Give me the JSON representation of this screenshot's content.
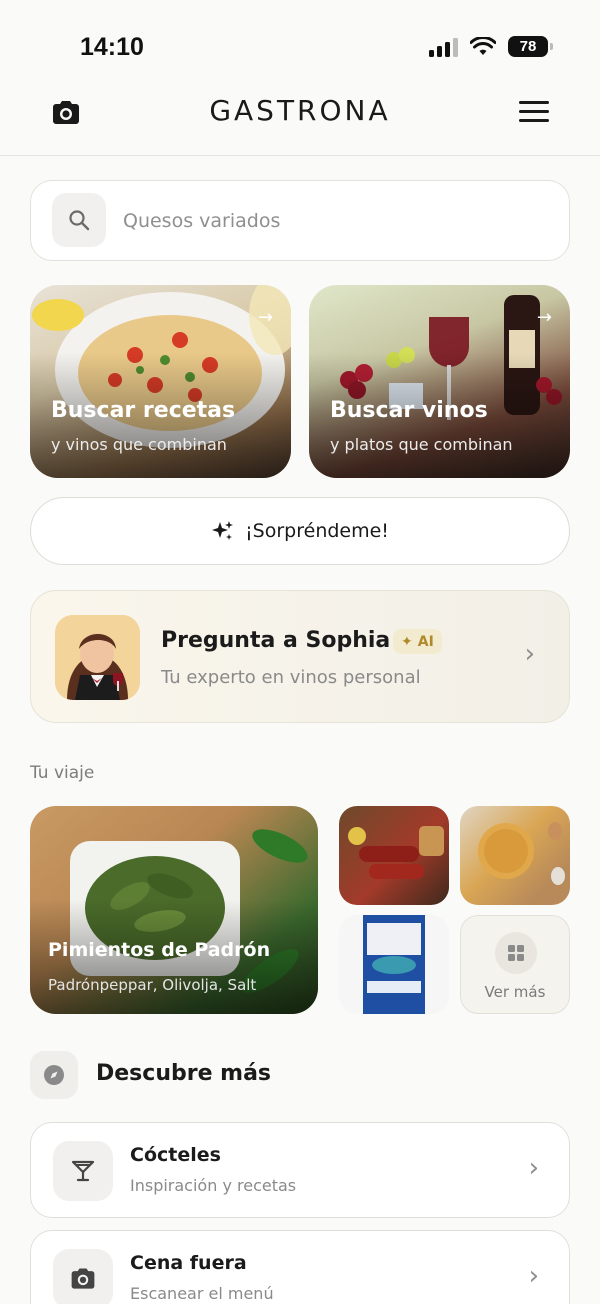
{
  "status": {
    "time": "14:10",
    "battery": "78"
  },
  "header": {
    "brand": "GASTRONA"
  },
  "search": {
    "placeholder": "Quesos variados"
  },
  "features": [
    {
      "title": "Buscar recetas",
      "subtitle": "y vinos que combinan"
    },
    {
      "title": "Buscar vinos",
      "subtitle": "y platos que combinan"
    }
  ],
  "surprise": {
    "label": "¡Sorpréndeme!"
  },
  "sophia": {
    "title": "Pregunta a Sophia",
    "badge": "AI",
    "subtitle": "Tu experto en vinos personal"
  },
  "journey": {
    "label": "Tu viaje",
    "main": {
      "title": "Pimientos de Padrón",
      "subtitle": "Padrónpeppar, Olivolja, Salt"
    },
    "more_label": "Ver más"
  },
  "discover": {
    "title": "Descubre más",
    "items": [
      {
        "title": "Cócteles",
        "subtitle": "Inspiración y recetas",
        "icon": "cocktail-icon"
      },
      {
        "title": "Cena fuera",
        "subtitle": "Escanear el menú",
        "icon": "camera-icon"
      }
    ]
  },
  "colors": {
    "background": "#fafaf8",
    "ai_badge": "#b08a2a"
  }
}
